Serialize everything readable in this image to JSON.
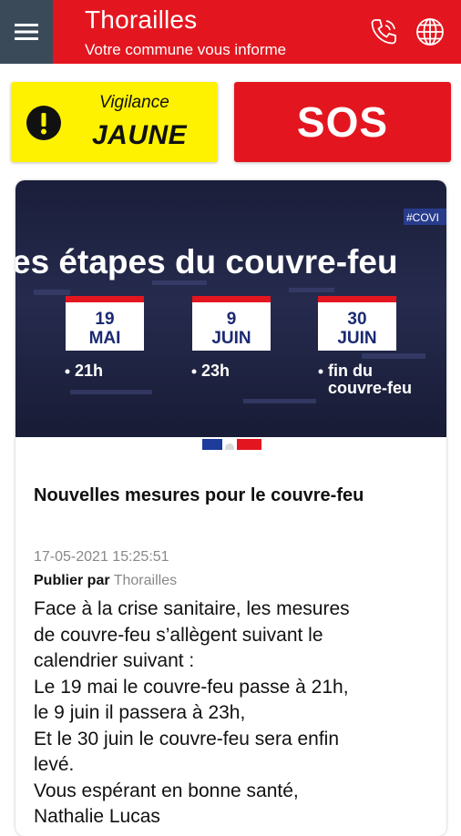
{
  "header": {
    "title": "Thorailles",
    "subtitle": "Votre commune vous informe",
    "menu_icon": "hamburger-menu-icon",
    "phone_icon": "phone-icon",
    "globe_icon": "globe-icon"
  },
  "alerts": {
    "vigilance_label": "Vigilance",
    "vigilance_level": "JAUNE",
    "vigilance_icon": "exclamation-icon",
    "sos_label": "SOS"
  },
  "article": {
    "banner": {
      "tag": "#COVI",
      "headline": "es étapes du couvre-feu",
      "steps": [
        {
          "day": "19",
          "month": "MAI",
          "caption_lines": [
            "21h"
          ]
        },
        {
          "day": "9",
          "month": "JUIN",
          "caption_lines": [
            "23h"
          ]
        },
        {
          "day": "30",
          "month": "JUIN",
          "caption_lines": [
            "fin du",
            "couvre-feu"
          ]
        }
      ]
    },
    "title": "Nouvelles mesures pour le couvre-feu",
    "date": "17-05-2021 15:25:51",
    "published_label": "Publier par",
    "publisher": "Thorailles",
    "body_lines": [
      "Face à la crise sanitaire, les mesures",
      "de couvre-feu s’allègent suivant le",
      "calendrier suivant  :",
      "Le 19 mai le couvre-feu passe à 21h,",
      "le 9 juin il passera à 23h,",
      "Et le 30 juin le couvre-feu sera enfin",
      "levé.",
      "Vous espérant en bonne santé,",
      "Nathalie Lucas"
    ]
  },
  "colors": {
    "brand_red": "#e3161f",
    "menu_bg": "#3b4a59",
    "vigilance_yellow": "#fff200",
    "banner_navy": "#1b2140"
  }
}
